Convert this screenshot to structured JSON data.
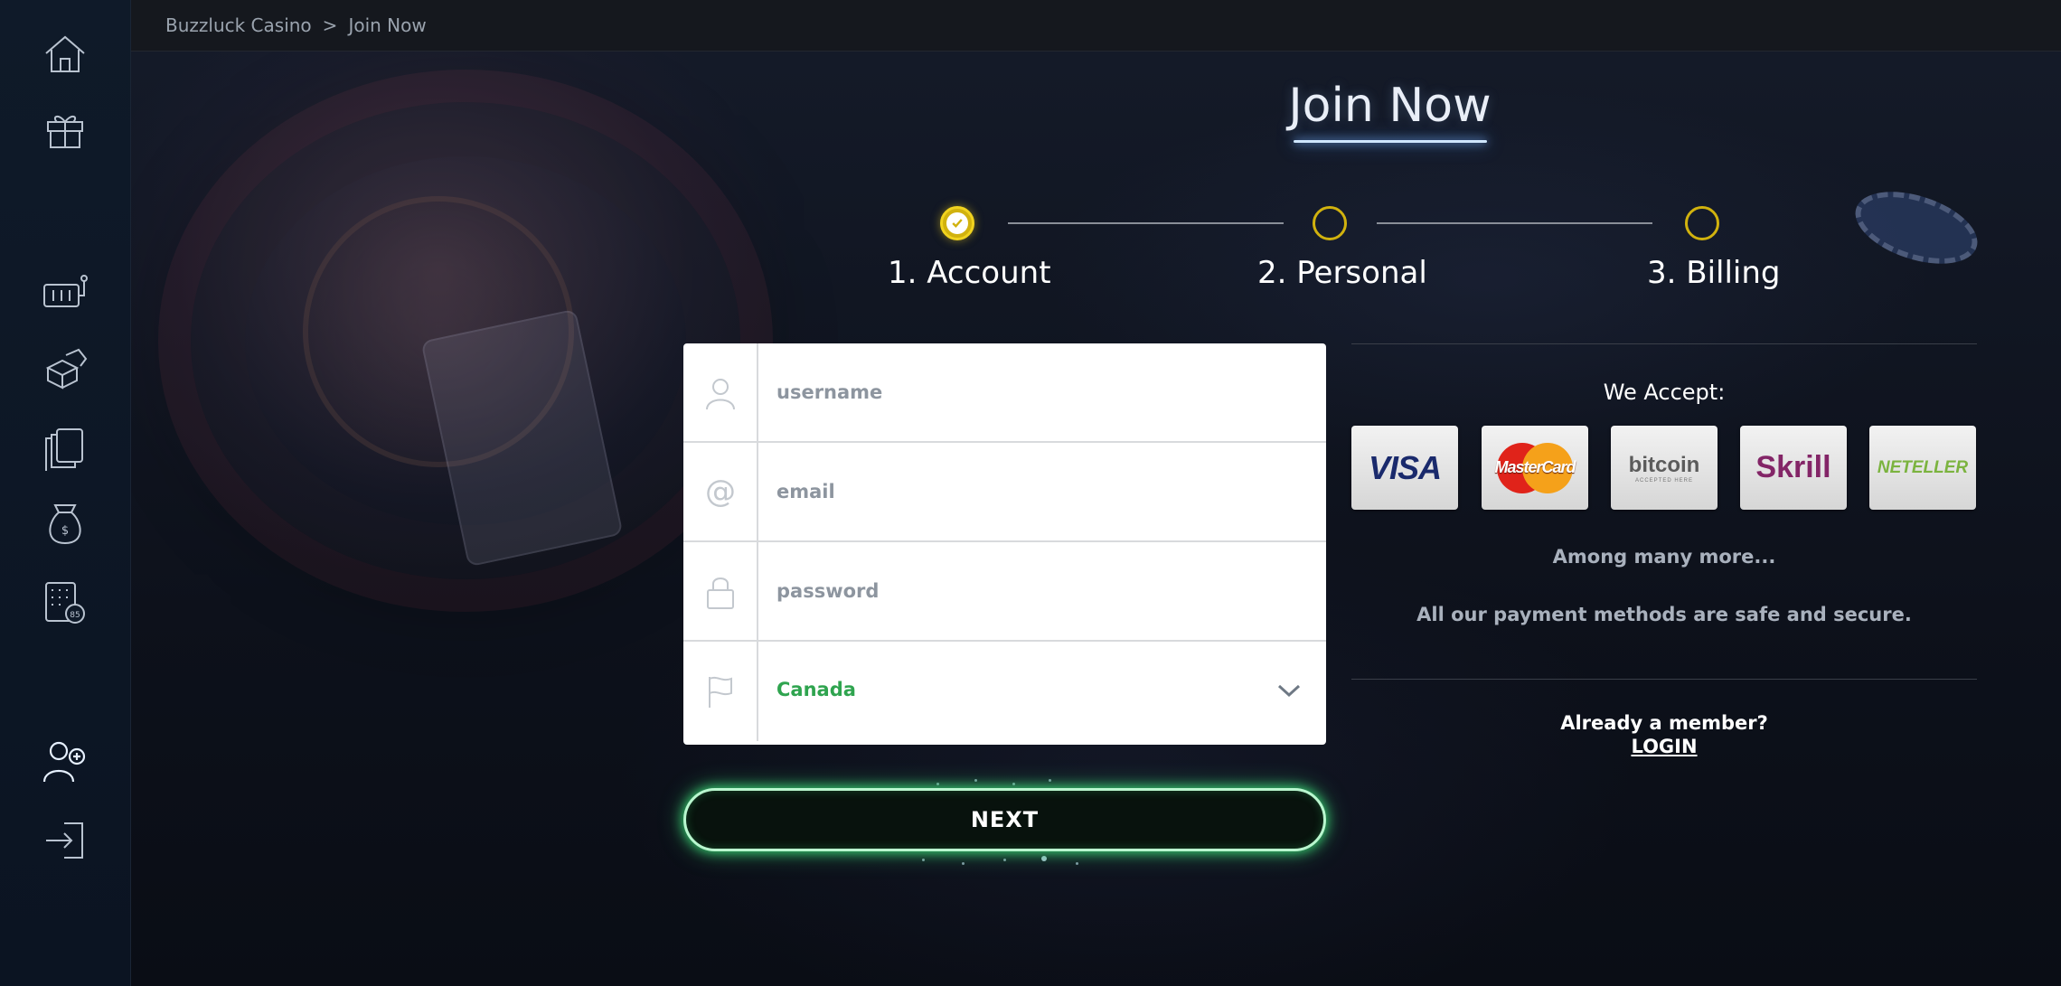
{
  "breadcrumb": {
    "home": "Buzzluck Casino",
    "separator": ">",
    "current": "Join Now"
  },
  "sidebar": {
    "items": [
      {
        "icon": "home-icon"
      },
      {
        "icon": "gift-icon"
      },
      {
        "icon": "slot-machine-icon"
      },
      {
        "icon": "dice-icon"
      },
      {
        "icon": "cards-icon"
      },
      {
        "icon": "money-bag-icon"
      },
      {
        "icon": "keno-icon"
      },
      {
        "icon": "add-user-icon"
      },
      {
        "icon": "login-icon"
      }
    ]
  },
  "page": {
    "title": "Join Now"
  },
  "steps": [
    {
      "label": "1. Account",
      "state": "complete"
    },
    {
      "label": "2. Personal",
      "state": "pending"
    },
    {
      "label": "3. Billing",
      "state": "pending"
    }
  ],
  "form": {
    "username_placeholder": "username",
    "email_placeholder": "email",
    "password_placeholder": "password",
    "country_value": "Canada",
    "next_label": "NEXT"
  },
  "payments": {
    "heading": "We Accept:",
    "methods": [
      "VISA",
      "MasterCard",
      "bitcoin",
      "Skrill",
      "NETELLER"
    ],
    "bitcoin_sub": "ACCEPTED HERE",
    "among": "Among many more...",
    "secure_note": "All our payment methods are safe and secure."
  },
  "member": {
    "question": "Already a member?",
    "login_label": "LOGIN"
  },
  "colors": {
    "accent_green": "#3ee27a",
    "step_gold": "#d1b20e",
    "country_green": "#2fa44f"
  }
}
